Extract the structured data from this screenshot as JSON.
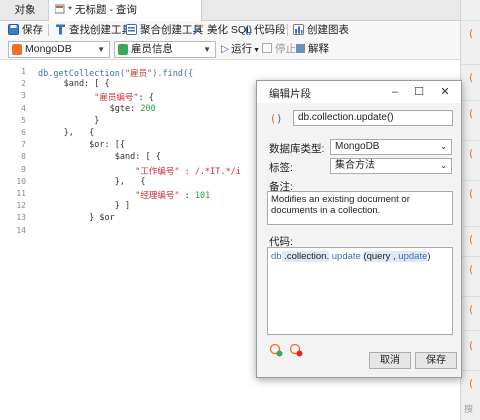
{
  "tabs": {
    "objects_label": "对象",
    "query_label": "* 无标题 - 查询"
  },
  "toolbar": {
    "save": "保存",
    "find_builder": "查找创建工具",
    "aggregate_builder": "聚合创建工具",
    "beautify": "美化 SQL",
    "snippets": "代码段",
    "create_chart": "创建图表"
  },
  "toolbar2": {
    "connection": "MongoDB",
    "database": "雇员信息",
    "run": "运行",
    "stop": "停止",
    "explain": "解释"
  },
  "editor": {
    "line_numbers": [
      "1",
      "2",
      "3",
      "4",
      "5",
      "6",
      "7",
      "8",
      "9",
      "10",
      "11",
      "12",
      "13",
      "14"
    ],
    "lines": [
      [
        {
          "t": "db.getCollection(",
          "c": "kw"
        },
        {
          "t": "\"雇员\"",
          "c": "str"
        },
        {
          "t": ").find({",
          "c": "kw"
        }
      ],
      [
        {
          "t": "     $and: [ {",
          "c": ""
        }
      ],
      [
        {
          "t": "           ",
          "c": ""
        },
        {
          "t": "\"雇员编号\"",
          "c": "str"
        },
        {
          "t": ": {",
          "c": ""
        }
      ],
      [
        {
          "t": "              $gte: ",
          "c": ""
        },
        {
          "t": "200",
          "c": "num"
        }
      ],
      [
        {
          "t": "           }",
          "c": ""
        }
      ],
      [
        {
          "t": "     },   {",
          "c": ""
        }
      ],
      [
        {
          "t": "          $or: [{",
          "c": ""
        }
      ],
      [
        {
          "t": "               $and: [ {",
          "c": ""
        }
      ],
      [
        {
          "t": "                   ",
          "c": ""
        },
        {
          "t": "\"工作编号\" : /.*IT.*/i",
          "c": "str"
        }
      ],
      [
        {
          "t": "               },   {",
          "c": ""
        }
      ],
      [
        {
          "t": "                   ",
          "c": ""
        },
        {
          "t": "\"经理编号\"",
          "c": "str"
        },
        {
          "t": " : ",
          "c": ""
        },
        {
          "t": "101",
          "c": "num"
        }
      ],
      [
        {
          "t": "               } ]",
          "c": ""
        }
      ],
      [
        {
          "t": "          } $or",
          "c": ""
        }
      ],
      [
        {
          "t": "",
          "c": ""
        }
      ]
    ]
  },
  "dialog": {
    "title": "编辑片段",
    "snippet_name": "db.collection.update()",
    "db_type_label": "数据库类型:",
    "db_type_value": "MongoDB",
    "tag_label": "标签:",
    "tag_value": "集合方法",
    "remark_label": "备注:",
    "remark_text": "Modifies an existing document or documents in a collection.",
    "code_label": "代码:",
    "code_parts": [
      {
        "t": "db",
        "c": "kw"
      },
      {
        "t": " .collection.",
        "c": "hl"
      },
      {
        "t": " update ",
        "c": "kw"
      },
      {
        "t": "(query ,",
        "c": "hl"
      },
      {
        "t": " update",
        "c": "kw hl"
      },
      {
        "t": ")",
        "c": ""
      }
    ],
    "cancel_label": "取消",
    "save_label": "保存"
  },
  "colors": {
    "accent_blue": "#3b6fb6",
    "string_red": "#d02c2c",
    "number_green": "#2e9b3e",
    "mongo_orange": "#e8722a",
    "db_green": "#3ba55c"
  },
  "right_strip": {
    "search_placeholder": "搜"
  }
}
